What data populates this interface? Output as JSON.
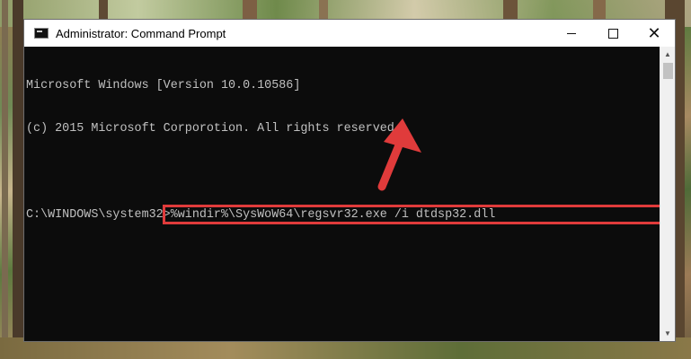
{
  "window": {
    "title": "Administrator: Command Prompt",
    "icon": "cmd-icon",
    "controls": {
      "minimize": "minimize-icon",
      "maximize": "maximize-icon",
      "close": "✕"
    }
  },
  "console": {
    "line1": "Microsoft Windows [Version 10.0.10586]",
    "line2": "(c) 2015 Microsoft Corporotion. All rights reserved.",
    "prompt": "C:\\WINDOWS\\system32>",
    "command": "%windir%\\SysWoW64\\regsvr32.exe /i dtdsp32.dll"
  },
  "colors": {
    "highlight": "#e03b3b",
    "console_bg": "#0c0c0c",
    "console_text": "#c0c0c0"
  },
  "scrollbar": {
    "up_icon": "▲",
    "down_icon": "▼"
  }
}
